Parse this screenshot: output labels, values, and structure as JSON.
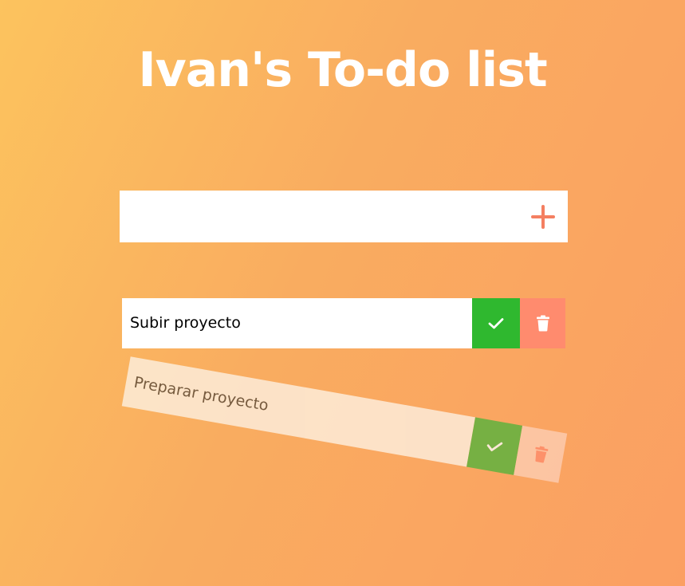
{
  "app": {
    "title": "Ivan's To-do list"
  },
  "add_form": {
    "input_value": "",
    "input_placeholder": "",
    "add_icon": "plus-icon"
  },
  "todos": [
    {
      "text": "Subir proyecto",
      "completed": false,
      "check_icon": "check-icon",
      "delete_icon": "trash-icon"
    },
    {
      "text": "Preparar proyecto",
      "completed": true,
      "check_icon": "check-icon",
      "delete_icon": "trash-icon"
    }
  ],
  "colors": {
    "gradient_start": "#fcc35e",
    "gradient_end": "#fb9f62",
    "accent": "#ff8b6e",
    "complete": "#2fb82f"
  }
}
